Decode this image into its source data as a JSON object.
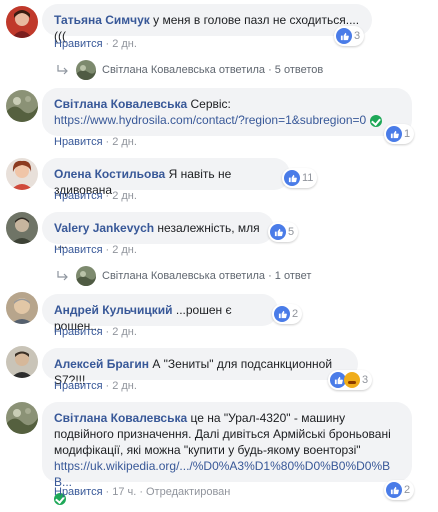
{
  "colors": {
    "link": "#385898",
    "bubble": "#f2f3f5",
    "meta": "#90949c",
    "like_reaction": "#4a7ce8"
  },
  "comments": [
    {
      "author": "Татьяна Симчук",
      "text": "у меня в голове пазл не сходиться....(((",
      "like": "Нравится",
      "time": "2 дн.",
      "reactions": "3",
      "replies": {
        "author": "Світлана Ковалевська",
        "action": "ответила",
        "count": "5 ответов"
      }
    },
    {
      "author": "Світлана Ковалевська",
      "text": "Сервіс:",
      "link": "https://www.hydrosila.com/contact/?region=1&subregion=0",
      "like": "Нравится",
      "time": "2 дн.",
      "reactions": "1"
    },
    {
      "author": "Олена Костильова",
      "text": "Я навіть не здивована",
      "like": "Нравится",
      "time": "2 дн.",
      "reactions": "11"
    },
    {
      "author": "Valery Jankevych",
      "text": "незалежність, мля ....",
      "like": "Нравится",
      "time": "2 дн.",
      "reactions": "5",
      "replies": {
        "author": "Світлана Ковалевська",
        "action": "ответила",
        "count": "1 ответ"
      }
    },
    {
      "author": "Андрей Кульчицкий",
      "text": "...рошен є рошен...",
      "like": "Нравится",
      "time": "2 дн.",
      "reactions": "2"
    },
    {
      "author": "Алексей Брагин",
      "text": "А \"Зениты\" для подсанкционной S7?!!!",
      "like": "Нравится",
      "time": "2 дн.",
      "reactions": "3"
    },
    {
      "author": "Світлана Ковалевська",
      "text": "це на \"Урал-4320\" - машину подвійного призначення. Далі дивіться Армійські броньовані модифікації, які можна \"купити у будь-якому военторзі\"",
      "link": "https://uk.wikipedia.org/.../%D0%A3%D1%80%D0%B0%D0%BB...",
      "like": "Нравится",
      "time": "17 ч.",
      "edited": "Отредактирован",
      "reactions": "2"
    }
  ]
}
